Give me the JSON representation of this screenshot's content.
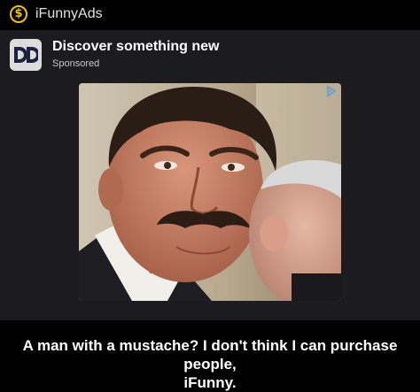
{
  "header": {
    "app_name": "iFunnyAds",
    "coin_symbol": "$",
    "coin_color": "#f2c200",
    "coin_icon": "dollar-coin-icon"
  },
  "ad": {
    "title": "Discover something new",
    "sponsored_label": "Sponsored",
    "logo_icon": "dd-app-logo-icon",
    "adchoices_icon": "adchoices-icon",
    "image_subject": "mustache-man-photo"
  },
  "caption": {
    "line1": "A man with a mustache? I don't think I can purchase people,",
    "line2": "iFunny."
  },
  "colors": {
    "background": "#000000",
    "card": "#1c1c20",
    "accent": "#f2c200",
    "adchoices": "#5aa0d8"
  }
}
